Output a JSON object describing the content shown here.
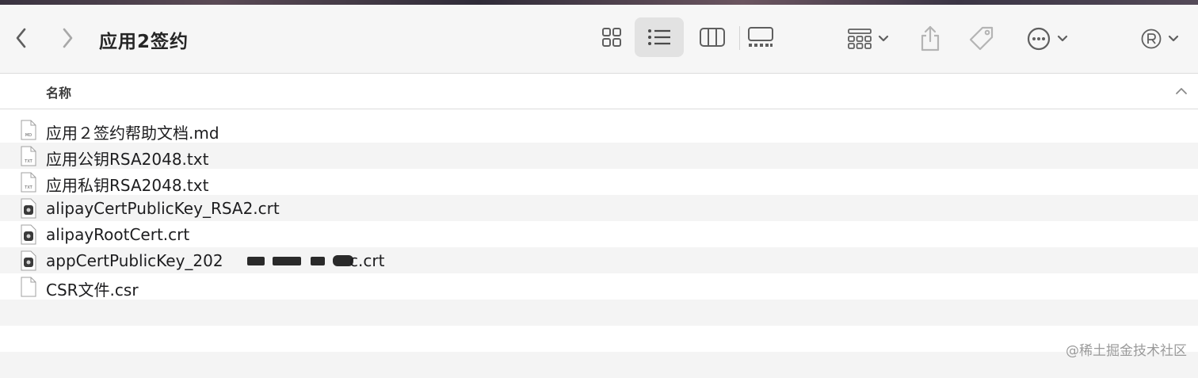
{
  "window": {
    "title": "应用2签约"
  },
  "toolbar": {
    "back_icon": "chevron-left-icon",
    "forward_icon": "chevron-right-icon",
    "views": [
      {
        "name": "icon-view",
        "icon": "grid-icon",
        "selected": false
      },
      {
        "name": "list-view",
        "icon": "list-icon",
        "selected": true
      },
      {
        "name": "column-view",
        "icon": "columns-icon",
        "selected": false
      },
      {
        "name": "gallery-view",
        "icon": "gallery-icon",
        "selected": false
      }
    ],
    "group_icon": "group-by-icon",
    "share_icon": "share-icon",
    "tag_icon": "tag-icon",
    "more_icon": "ellipsis-circle-icon",
    "account_icon": "registered-icon"
  },
  "table": {
    "column_name": "名称",
    "sort_direction": "ascending",
    "files": [
      {
        "name": "应用２签约帮助文档.md",
        "type": "md",
        "icon_label": "MD"
      },
      {
        "name": "应用公钥RSA2048.txt",
        "type": "txt",
        "icon_label": "TXT"
      },
      {
        "name": "应用私钥RSA2048.txt",
        "type": "txt",
        "icon_label": "TXT"
      },
      {
        "name": "alipayCertPublicKey_RSA2.crt",
        "type": "crt"
      },
      {
        "name": "alipayRootCert.crt",
        "type": "crt"
      },
      {
        "name": "appCertPublicKey_202",
        "suffix": "c.crt",
        "type": "crt",
        "redacted": true
      },
      {
        "name": "CSR文件.csr",
        "type": "csr"
      }
    ]
  },
  "watermark": "@稀土掘金技术社区",
  "colors": {
    "toolbar_bg": "#f6f6f6",
    "alt_row_bg": "#f4f4f4",
    "selected_view_bg": "#e2e2e2",
    "icon_color": "#5f5f5f"
  }
}
